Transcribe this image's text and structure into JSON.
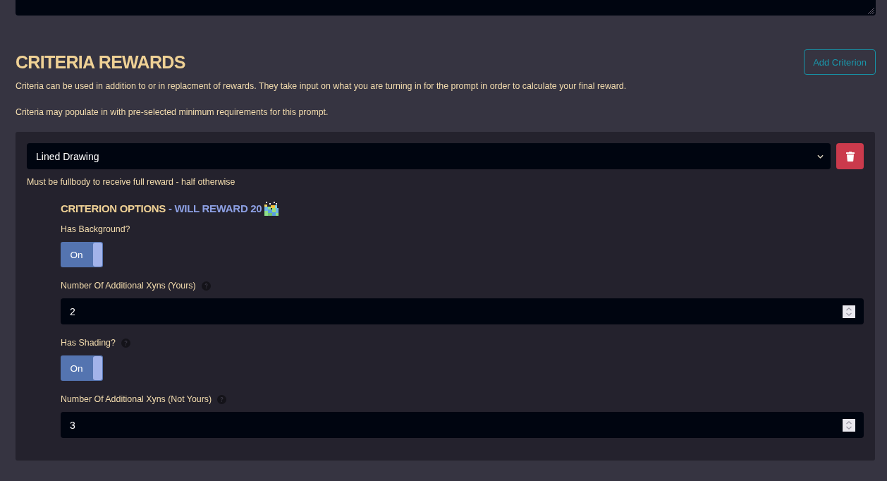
{
  "section": {
    "title": "CRITERIA REWARDS",
    "add_button": "Add Criterion",
    "paragraphs": [
      "Criteria can be used in addition to or in replacment of rewards. They take input on what you are turning in for the prompt in order to calculate your final reward.",
      "Criteria may populate in with pre-selected minimum requirements for this prompt."
    ]
  },
  "criteria": [
    {
      "selected_option": "Lined Drawing",
      "description": "Must be fullbody to receive full reward - half otherwise",
      "options_heading": "CRITERION OPTIONS",
      "reward_text": "- WILL REWARD 20",
      "fields": [
        {
          "kind": "toggle",
          "label": "Has Background?",
          "help": false,
          "on": true,
          "toggle_text": "On"
        },
        {
          "kind": "number",
          "label": "Number Of Additional Xyns (Yours)",
          "help": true,
          "value": "2"
        },
        {
          "kind": "toggle",
          "label": "Has Shading?",
          "help": true,
          "on": true,
          "toggle_text": "On"
        },
        {
          "kind": "number",
          "label": "Number Of Additional Xyns (Not Yours)",
          "help": true,
          "value": "3"
        }
      ]
    }
  ]
}
